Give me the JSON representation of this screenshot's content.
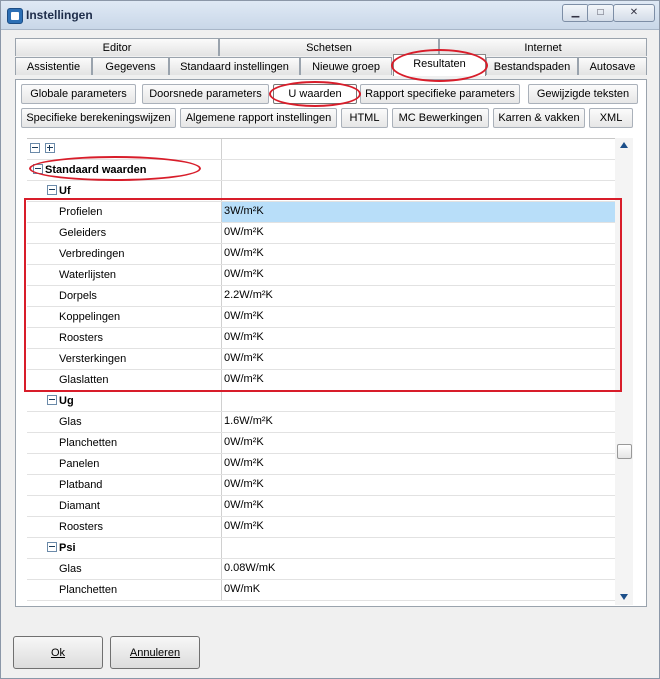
{
  "window": {
    "title": "Instellingen",
    "minimize_label": "▁",
    "maximize_label": "□",
    "close_label": "✕"
  },
  "tabs_top": [
    "Editor",
    "Schetsen",
    "Internet"
  ],
  "tabs_bottom": [
    "Assistentie",
    "Gegevens",
    "Standaard instellingen",
    "Nieuwe groep",
    "Resultaten",
    "Bestandspaden",
    "Autosave"
  ],
  "subtabs_row1": [
    "Globale parameters",
    "Doorsnede parameters",
    "U waarden",
    "Rapport specifieke parameters",
    "Gewijzigde teksten"
  ],
  "subtabs_row2": [
    "Specifieke berekeningswijzen",
    "Algemene rapport instellingen",
    "HTML",
    "MC Bewerkingen",
    "Karren & vakken",
    "XML"
  ],
  "grid": {
    "header": "Standaard waarden",
    "groups": [
      {
        "name": "Uf",
        "rows": [
          {
            "name": "Profielen",
            "value": "3W/m²K"
          },
          {
            "name": "Geleiders",
            "value": "0W/m²K"
          },
          {
            "name": "Verbredingen",
            "value": "0W/m²K"
          },
          {
            "name": "Waterlijsten",
            "value": "0W/m²K"
          },
          {
            "name": "Dorpels",
            "value": "2.2W/m²K"
          },
          {
            "name": "Koppelingen",
            "value": "0W/m²K"
          },
          {
            "name": "Roosters",
            "value": "0W/m²K"
          },
          {
            "name": "Versterkingen",
            "value": "0W/m²K"
          },
          {
            "name": "Glaslatten",
            "value": "0W/m²K"
          }
        ]
      },
      {
        "name": "Ug",
        "rows": [
          {
            "name": "Glas",
            "value": "1.6W/m²K"
          },
          {
            "name": "Planchetten",
            "value": "0W/m²K"
          },
          {
            "name": "Panelen",
            "value": "0W/m²K"
          },
          {
            "name": "Platband",
            "value": "0W/m²K"
          },
          {
            "name": "Diamant",
            "value": "0W/m²K"
          },
          {
            "name": "Roosters",
            "value": "0W/m²K"
          }
        ]
      },
      {
        "name": "Psi",
        "rows": [
          {
            "name": "Glas",
            "value": "0.08W/mK"
          },
          {
            "name": "Planchetten",
            "value": "0W/mK"
          }
        ]
      }
    ]
  },
  "buttons": {
    "ok": "Ok",
    "cancel": "Annuleren"
  },
  "colors": {
    "annotation": "#d81d2a",
    "selection": "#b8def9"
  }
}
